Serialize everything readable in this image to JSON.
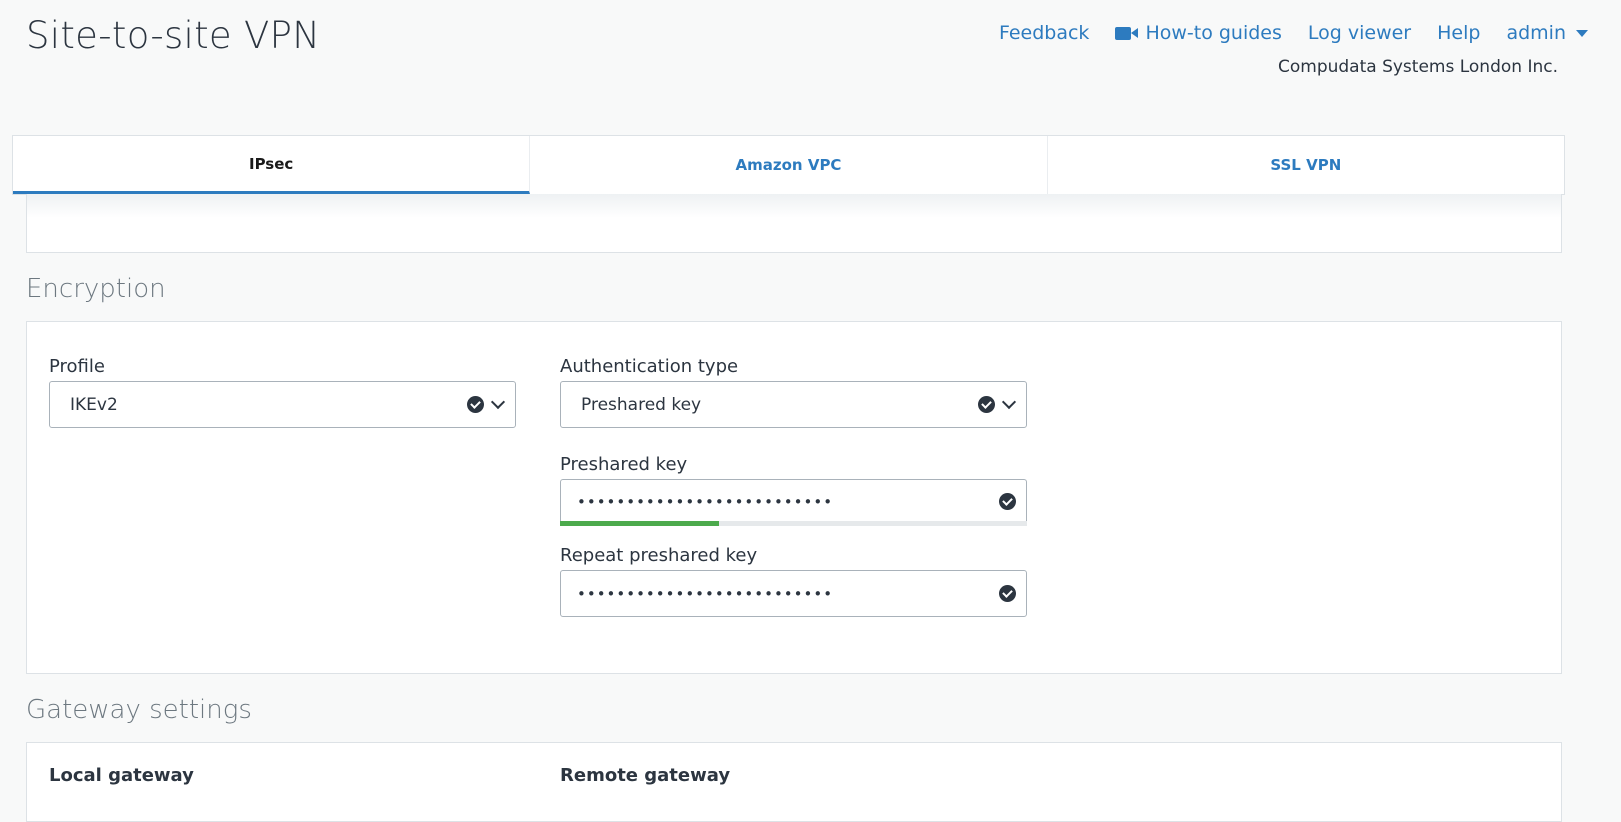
{
  "header": {
    "title": "Site-to-site VPN",
    "links": [
      {
        "label": "Feedback"
      },
      {
        "label": "How-to guides",
        "icon": "video-camera-icon"
      },
      {
        "label": "Log viewer"
      },
      {
        "label": "Help"
      },
      {
        "label": "admin",
        "icon": "caret-down-icon"
      }
    ],
    "company": "Compudata Systems London Inc."
  },
  "tabs": [
    {
      "label": "IPsec",
      "active": true
    },
    {
      "label": "Amazon VPC",
      "active": false
    },
    {
      "label": "SSL VPN",
      "active": false
    }
  ],
  "encryption": {
    "title": "Encryption",
    "profile": {
      "label": "Profile",
      "value": "IKEv2"
    },
    "auth_type": {
      "label": "Authentication type",
      "value": "Preshared key"
    },
    "preshared_key": {
      "label": "Preshared key",
      "value": "••••••••••••••••••••••••••",
      "strength": 0.34
    },
    "repeat_key": {
      "label": "Repeat preshared key",
      "value": "••••••••••••••••••••••••••"
    }
  },
  "gateway": {
    "title": "Gateway settings",
    "local_label": "Local gateway",
    "remote_label": "Remote gateway"
  },
  "colors": {
    "accent": "#2d7bbf",
    "strength": "#4caa4c"
  }
}
